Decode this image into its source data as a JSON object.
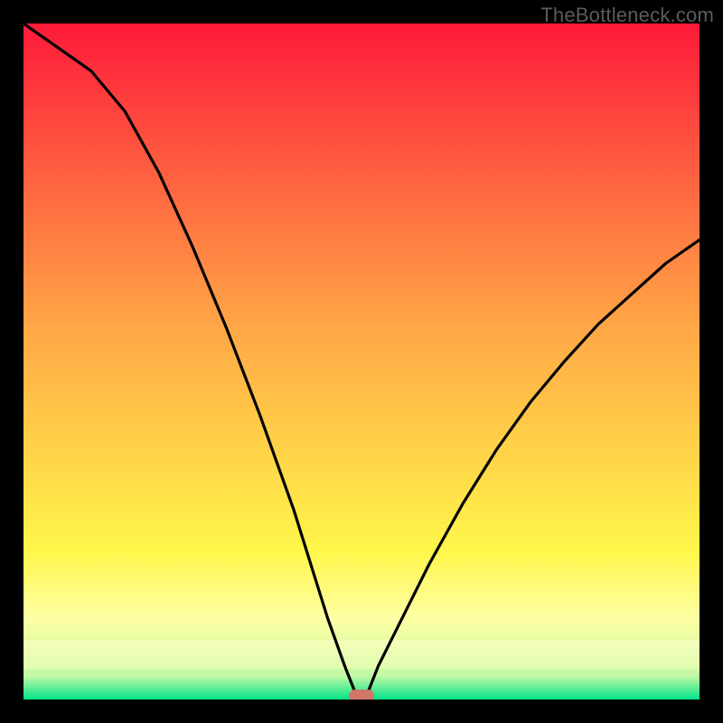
{
  "watermark": "TheBottleneck.com",
  "colors": {
    "black": "#000000",
    "red_top": "#fe1a3a",
    "orange_mid": "#ffa746",
    "yellow_low": "#fff64a",
    "pale_yellow": "#feffa4",
    "pale_green": "#c3f9a5",
    "green": "#00e389",
    "curve": "#000000",
    "marker": "#d1776a",
    "watermark_text": "#5b5b5b"
  },
  "chart_data": {
    "type": "line",
    "title": "",
    "xlabel": "",
    "ylabel": "",
    "xlim": [
      0,
      1
    ],
    "ylim": [
      0,
      1
    ],
    "x": [
      0.0,
      0.05,
      0.1,
      0.15,
      0.2,
      0.25,
      0.3,
      0.35,
      0.4,
      0.45,
      0.475,
      0.49,
      0.5,
      0.51,
      0.525,
      0.55,
      0.6,
      0.65,
      0.7,
      0.75,
      0.8,
      0.85,
      0.9,
      0.95,
      1.0
    ],
    "series": [
      {
        "name": "bottleneck-curve",
        "values": [
          1.0,
          0.965,
          0.93,
          0.87,
          0.78,
          0.67,
          0.55,
          0.42,
          0.28,
          0.12,
          0.05,
          0.012,
          0.0,
          0.012,
          0.05,
          0.1,
          0.2,
          0.29,
          0.37,
          0.44,
          0.5,
          0.555,
          0.6,
          0.645,
          0.68
        ]
      }
    ],
    "minimum_point": {
      "x": 0.5,
      "y": 0.0
    },
    "marker": {
      "x": 0.5,
      "y": 0.006
    },
    "background_gradient_stops": [
      {
        "pos": 0.0,
        "color": "#fe1a3a"
      },
      {
        "pos": 0.45,
        "color": "#ffa746"
      },
      {
        "pos": 0.78,
        "color": "#fff64a"
      },
      {
        "pos": 0.88,
        "color": "#feffa4"
      },
      {
        "pos": 0.97,
        "color": "#c3f9a5"
      },
      {
        "pos": 1.0,
        "color": "#00e389"
      }
    ]
  }
}
